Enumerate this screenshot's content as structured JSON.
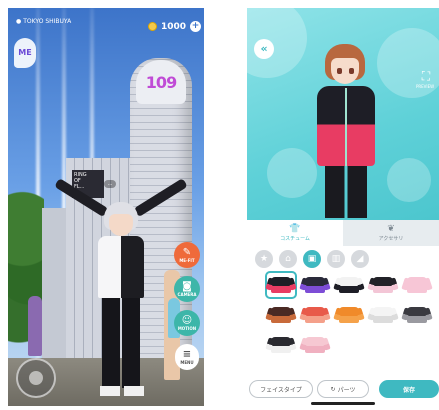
{
  "ar_view": {
    "location": "TOKYO SHIBUYA",
    "coins": "1000",
    "plus_glyph": "+",
    "tower_logo": "109",
    "sign_lines": [
      "RING",
      "OF",
      "FL..."
    ],
    "info_chip": "...",
    "side_buttons": [
      {
        "name": "me-fit",
        "label": "ME-FIT",
        "icon": "hanger-icon",
        "glyph": "✎"
      },
      {
        "name": "camera",
        "label": "CAMERA",
        "icon": "camera-icon",
        "glyph": "◙"
      },
      {
        "name": "motion",
        "label": "MOTION",
        "icon": "smile-icon",
        "glyph": "☺"
      },
      {
        "name": "menu",
        "label": "MENU",
        "icon": "menu-icon",
        "glyph": "≡"
      }
    ],
    "menu_badge": "ME",
    "colors": {
      "accent_orange": "#ef6a3a",
      "accent_teal": "#3db6a9"
    }
  },
  "editor": {
    "back_glyph": "«",
    "expand_glyph": "⛶",
    "expand_label": "PREVIEW",
    "tabs": [
      {
        "label": "コスチューム",
        "icon": "shirt-icon",
        "glyph": "👕"
      },
      {
        "label": "アクセサリ",
        "icon": "necklace-icon",
        "glyph": "❦"
      }
    ],
    "categories": [
      {
        "icon": "star-icon",
        "glyph": "★"
      },
      {
        "icon": "hat-icon",
        "glyph": "⌂"
      },
      {
        "icon": "shirt-icon",
        "glyph": "▣"
      },
      {
        "icon": "pants-icon",
        "glyph": "▥"
      },
      {
        "icon": "shoe-icon",
        "glyph": "◢"
      }
    ],
    "items": [
      {
        "color": "#1e1e26",
        "accent": "#e83c63",
        "selected": true
      },
      {
        "color": "#2a2a3a",
        "accent": "#7d4dd6"
      },
      {
        "color": "#f2f2f2",
        "accent": "#1e1e26"
      },
      {
        "color": "#222228",
        "accent": "#f3c6d6"
      },
      {
        "color": "#f7c6d6",
        "accent": "#f7c6d6"
      },
      {
        "color": "#4a2a24",
        "accent": "#c86a3a"
      },
      {
        "color": "#e85a4a",
        "accent": "#f4a08a"
      },
      {
        "color": "#f08a2a",
        "accent": "#f5a24a"
      },
      {
        "color": "#f4f4f4",
        "accent": "#dcdcdc"
      },
      {
        "color": "#3a3a40",
        "accent": "#9a9aa0"
      },
      {
        "color": "#2a2a30",
        "accent": "#f0f0f0"
      },
      {
        "color": "#f6c8d2",
        "accent": "#f0b0c0"
      }
    ],
    "buttons": {
      "face_type": "フェイスタイプ",
      "parts": "パーツ",
      "parts_glyph": "↻",
      "save": "保存"
    },
    "colors": {
      "accent": "#3fb9c1",
      "preview_bg": "#5fd1d8"
    }
  }
}
